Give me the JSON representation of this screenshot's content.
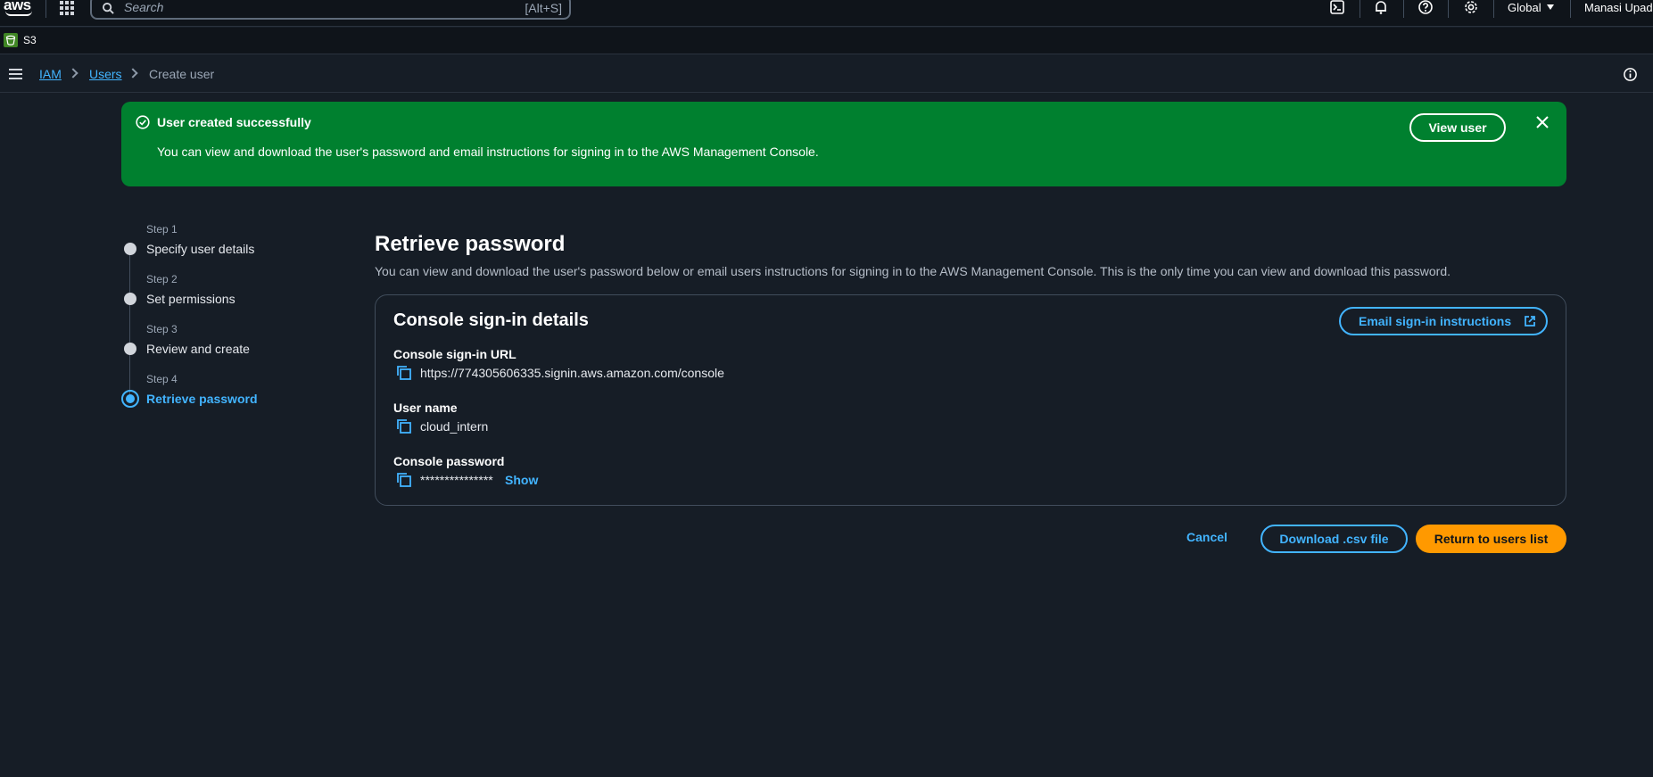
{
  "topnav": {
    "logo": "aws",
    "search": {
      "placeholder": "Search",
      "shortcut": "[Alt+S]"
    },
    "icons": [
      "cloudshell-icon",
      "bell-icon",
      "help-icon",
      "gear-icon"
    ],
    "region": "Global",
    "account": "Manasi Upadh"
  },
  "servicebar": {
    "service": "S3"
  },
  "breadcrumb": {
    "items": [
      "IAM",
      "Users",
      "Create user"
    ]
  },
  "flash": {
    "type": "success",
    "title": "User created successfully",
    "message": "You can view and download the user's password and email instructions for signing in to the AWS Management Console.",
    "action": "View user"
  },
  "steps": [
    {
      "number": "Step 1",
      "label": "Specify user details"
    },
    {
      "number": "Step 2",
      "label": "Set permissions"
    },
    {
      "number": "Step 3",
      "label": "Review and create"
    },
    {
      "number": "Step 4",
      "label": "Retrieve password",
      "active": true
    }
  ],
  "main": {
    "title": "Retrieve password",
    "description": "You can view and download the user's password below or email users instructions for signing in to the AWS Management Console. This is the only time you can view and download this password.",
    "container": {
      "title": "Console sign-in details",
      "email_button": "Email sign-in instructions",
      "fields": [
        {
          "label": "Console sign-in URL",
          "value": "https://774305606335.signin.aws.amazon.com/console"
        },
        {
          "label": "User name",
          "value": "cloud_intern"
        },
        {
          "label": "Console password",
          "value": "***************",
          "show": "Show"
        }
      ]
    },
    "actions": {
      "cancel": "Cancel",
      "download": "Download .csv file",
      "primary": "Return to users list"
    }
  },
  "colors": {
    "background": "#161d26",
    "nav": "#0f141a",
    "link": "#42b4ff",
    "success": "#00802f",
    "primary_button": "#ff9900"
  }
}
